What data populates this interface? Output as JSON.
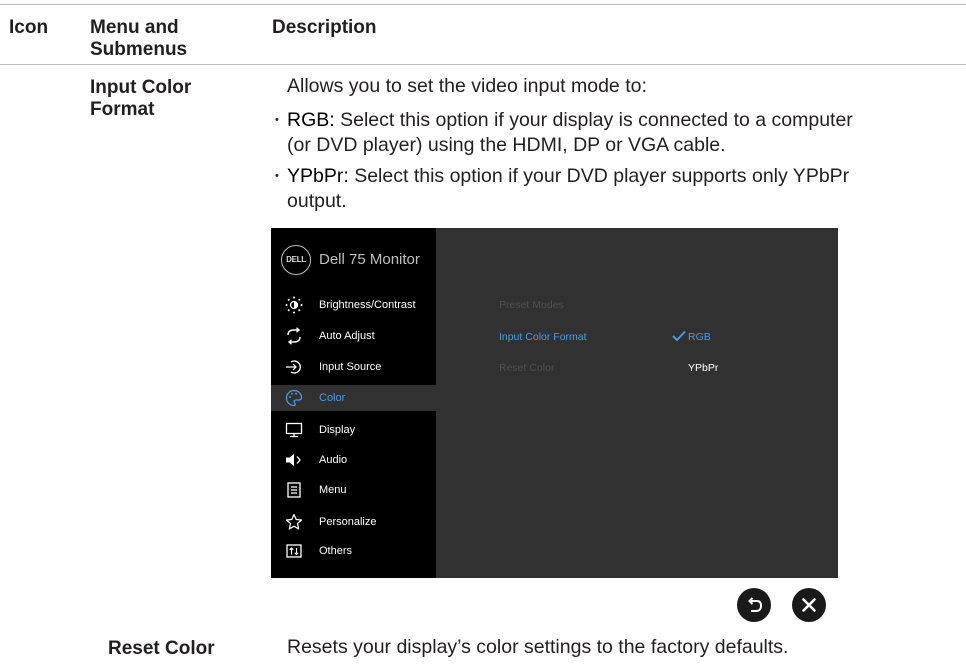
{
  "table": {
    "headers": {
      "icon": "Icon",
      "menu_line1": "Menu and",
      "menu_line2": "Submenus",
      "description": "Description"
    },
    "rows": [
      {
        "name_line1": "Input Color",
        "name_line2": "Format",
        "intro": "Allows you to set the video input mode to:",
        "bullets": [
          {
            "term": "RGB:",
            "line1": " Select this option if your display is connected to a computer",
            "line2": "(or DVD player) using the HDMI, DP or VGA cable."
          },
          {
            "term": "YPbPr:",
            "line1": " Select this option if your DVD player supports only YPbPr",
            "line2": "output."
          }
        ]
      },
      {
        "name": "Reset Color",
        "description": "Resets your display’s color settings to the factory defaults."
      }
    ]
  },
  "osd": {
    "logo_text": "DELL",
    "title": "Dell 75 Monitor",
    "menu_items": [
      {
        "label": "Brightness/Contrast",
        "icon": "brightness-icon",
        "active": false
      },
      {
        "label": "Auto Adjust",
        "icon": "auto-adjust-icon",
        "active": false
      },
      {
        "label": "Input Source",
        "icon": "input-source-icon",
        "active": false
      },
      {
        "label": "Color",
        "icon": "color-palette-icon",
        "active": true
      },
      {
        "label": "Display",
        "icon": "display-icon",
        "active": false
      },
      {
        "label": "Audio",
        "icon": "speaker-icon",
        "active": false
      },
      {
        "label": "Menu",
        "icon": "menu-icon",
        "active": false
      },
      {
        "label": "Personalize",
        "icon": "star-icon",
        "active": false
      },
      {
        "label": "Others",
        "icon": "others-icon",
        "active": false
      }
    ],
    "submenu": {
      "preset_modes": "Preset Modes",
      "input_color_format": "Input Color Format",
      "reset_color": "Reset Color"
    },
    "options": {
      "selected": "RGB",
      "other": "YPbPr"
    },
    "buttons": {
      "back_icon": "back-icon",
      "close_icon": "close-icon"
    },
    "colors": {
      "highlight": "#4a9ae6",
      "panel": "#313131",
      "sidebar": "#000000"
    }
  }
}
